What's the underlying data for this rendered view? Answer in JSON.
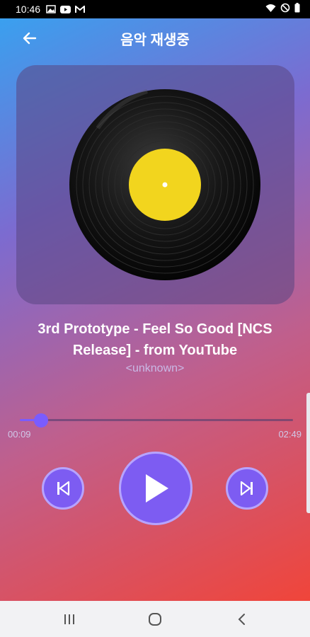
{
  "status_bar": {
    "time": "10:46",
    "left_icons": [
      "gallery-icon",
      "youtube-icon",
      "gmail-icon"
    ],
    "right_icons": [
      "wifi-icon",
      "do-not-disturb-icon",
      "battery-icon"
    ]
  },
  "header": {
    "title": "음악 재생중",
    "back_icon": "arrow-left-icon"
  },
  "album_art": {
    "icon": "vinyl-record-icon",
    "label_color": "#f2d51e"
  },
  "track": {
    "title": "3rd Prototype - Feel So Good [NCS Release] - from YouTube",
    "artist": "<unknown>"
  },
  "progress": {
    "current": "00:09",
    "total": "02:49",
    "fraction": 0.053
  },
  "controls": {
    "previous_icon": "skip-previous-icon",
    "play_icon": "play-icon",
    "next_icon": "skip-next-icon",
    "accent": "#7d5cf2"
  },
  "nav_bar": {
    "items": [
      "recents-icon",
      "home-icon",
      "back-icon"
    ]
  }
}
